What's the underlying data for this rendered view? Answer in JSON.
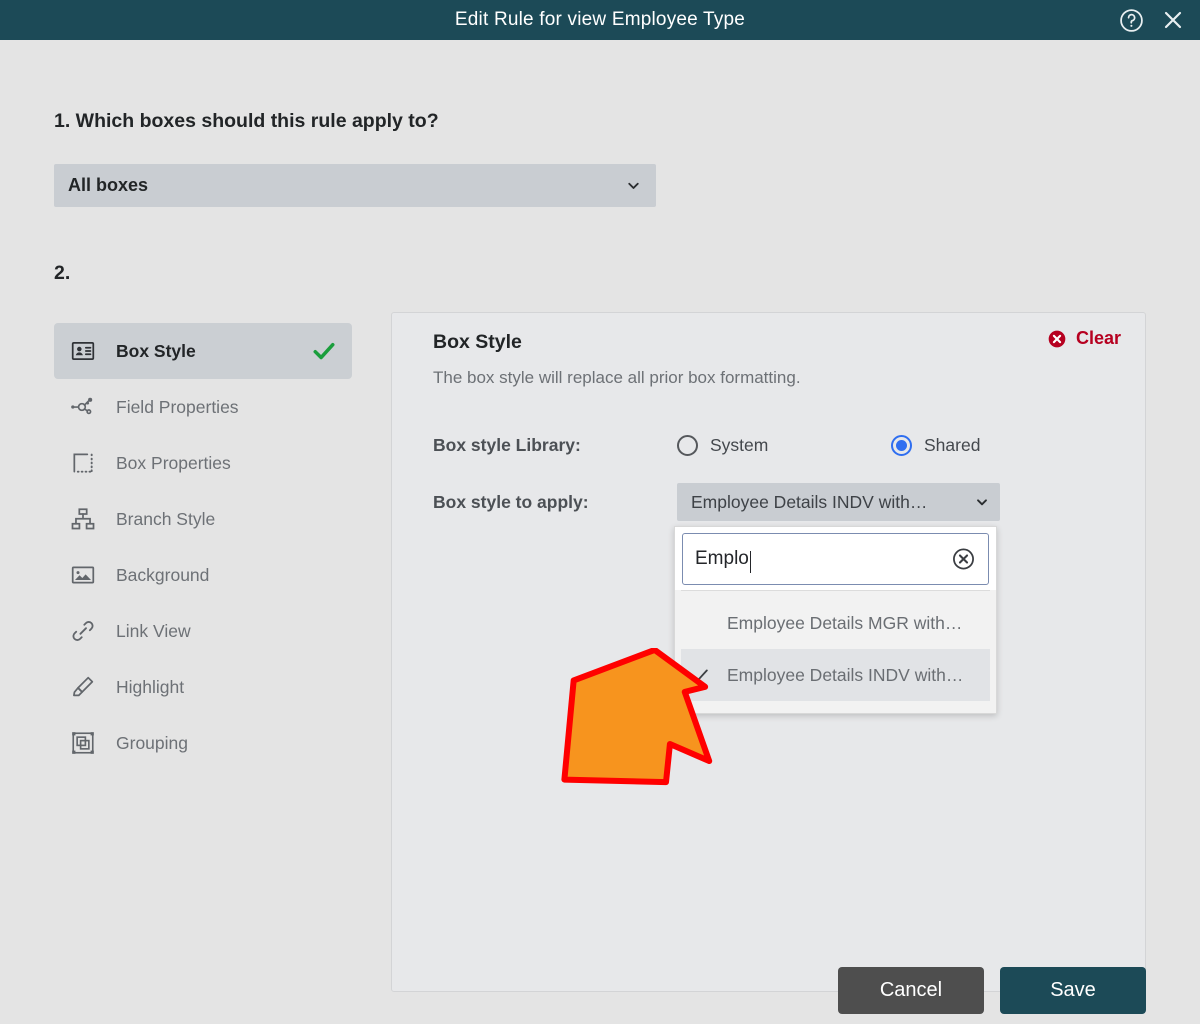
{
  "titlebar": {
    "title": "Edit Rule for view Employee Type",
    "help_icon": "help-circle-icon",
    "close_icon": "close-icon",
    "background": "#1c4a57"
  },
  "step1": {
    "heading": "1. Which boxes should this rule apply to?",
    "select_value": "All boxes",
    "chevron_icon": "chevron-down-icon"
  },
  "step2": {
    "heading": "2."
  },
  "sidebar": {
    "items": [
      {
        "label": "Box Style",
        "icon": "id-card-icon",
        "active": true,
        "check_icon": "check-icon"
      },
      {
        "label": "Field Properties",
        "icon": "node-graph-icon",
        "active": false
      },
      {
        "label": "Box Properties",
        "icon": "dashed-box-icon",
        "active": false
      },
      {
        "label": "Branch Style",
        "icon": "org-chart-icon",
        "active": false
      },
      {
        "label": "Background",
        "icon": "image-icon",
        "active": false
      },
      {
        "label": "Link View",
        "icon": "link-chain-icon",
        "active": false
      },
      {
        "label": "Highlight",
        "icon": "highlighter-icon",
        "active": false
      },
      {
        "label": "Grouping",
        "icon": "grouping-frame-icon",
        "active": false
      }
    ]
  },
  "panel": {
    "title": "Box Style",
    "subtitle": "The box style will replace all prior box formatting.",
    "clear_label": "Clear",
    "clear_icon": "error-circle-x-icon",
    "clear_color": "#b60020",
    "library_label": "Box style Library:",
    "library_options": [
      {
        "label": "System",
        "selected": false
      },
      {
        "label": "Shared",
        "selected": true
      }
    ],
    "apply_label": "Box style to apply:",
    "apply_value": "Employee Details INDV with…",
    "apply_chevron_icon": "chevron-down-icon",
    "radio_accent": "#2f6ef0"
  },
  "dropdown": {
    "search_value": "Emplo",
    "search_placeholder": "",
    "clear_icon": "circle-x-icon",
    "options": [
      {
        "label": "Employee Details MGR with…",
        "selected": false
      },
      {
        "label": "Employee Details INDV with…",
        "selected": true,
        "check_icon": "check-icon"
      }
    ]
  },
  "annotation": {
    "arrow": "orange-arrow-pointing-up-right",
    "fill": "#f7941e",
    "stroke": "#ff0000"
  },
  "footer": {
    "cancel_label": "Cancel",
    "save_label": "Save",
    "cancel_color": "#4e4e4e",
    "save_color": "#1c4a57"
  }
}
